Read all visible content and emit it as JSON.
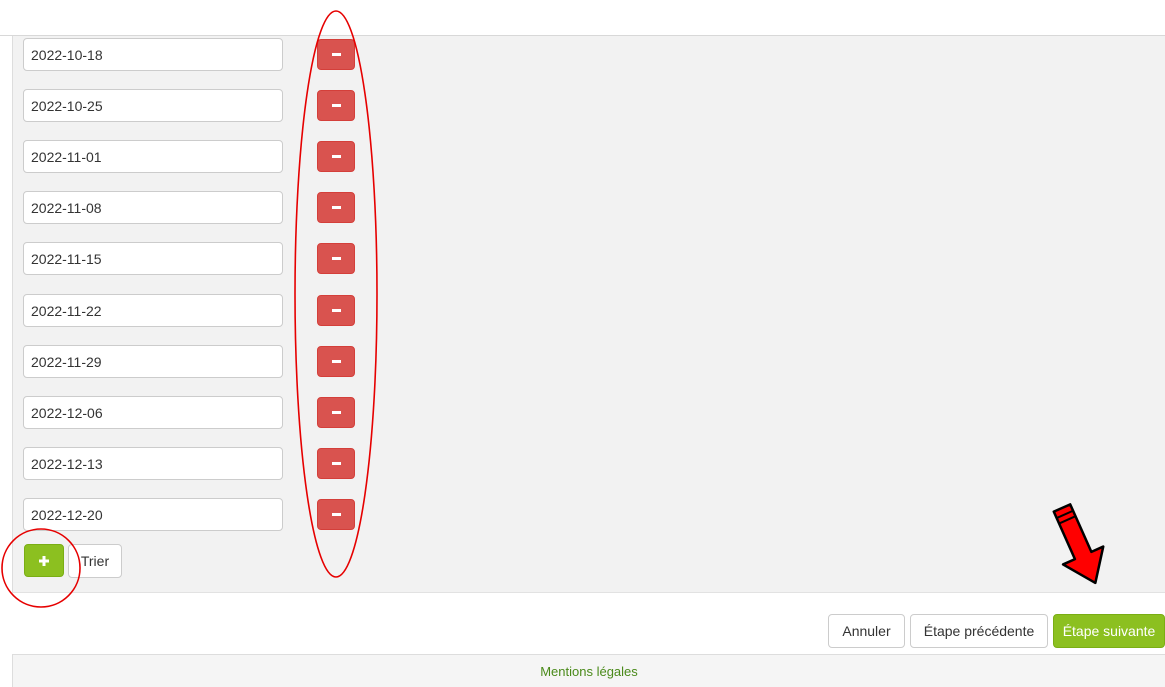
{
  "dates": [
    "2022-10-18",
    "2022-10-25",
    "2022-11-01",
    "2022-11-08",
    "2022-11-15",
    "2022-11-22",
    "2022-11-29",
    "2022-12-06",
    "2022-12-13",
    "2022-12-20"
  ],
  "actions": {
    "sort_label": "Trier"
  },
  "wizard": {
    "cancel_label": "Annuler",
    "previous_label": "Étape précédente",
    "next_label": "Étape suivante"
  },
  "footer": {
    "legal_label": "Mentions légales"
  },
  "colors": {
    "danger": "#d9534f",
    "success": "#8cc020",
    "annotation": "#e60000"
  },
  "icons": {
    "remove": "minus-icon",
    "add": "plus-icon"
  }
}
